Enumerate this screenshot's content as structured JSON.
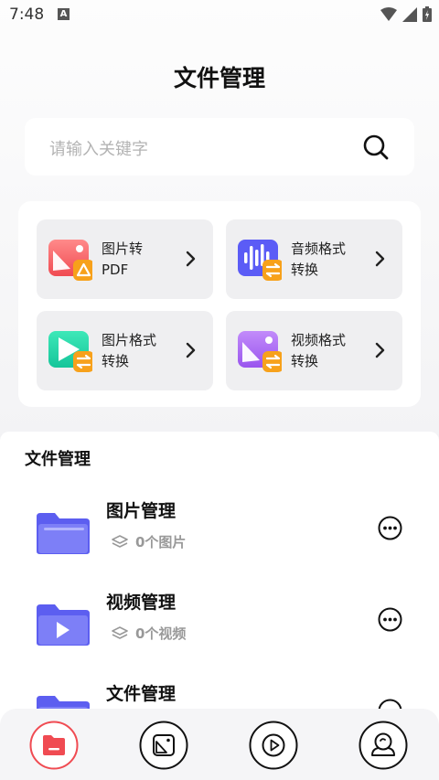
{
  "status_bar": {
    "time": "7:48",
    "notification_badge": "A"
  },
  "page_title": "文件管理",
  "search": {
    "placeholder": "请输入关键字"
  },
  "tools": [
    {
      "label_line1": "图片转",
      "label_line2": "PDF",
      "icon": "image-to-pdf-icon",
      "color": "#f2626b"
    },
    {
      "label_line1": "音频格式",
      "label_line2": "转换",
      "icon": "audio-convert-icon",
      "color": "#5b5cf6"
    },
    {
      "label_line1": "图片格式",
      "label_line2": "转换",
      "icon": "image-convert-icon",
      "color": "#22d2a5"
    },
    {
      "label_line1": "视频格式",
      "label_line2": "转换",
      "icon": "video-convert-icon",
      "color": "#b06ef0"
    }
  ],
  "section_title": "文件管理",
  "files": [
    {
      "name": "图片管理",
      "count": "0个图片"
    },
    {
      "name": "视频管理",
      "count": "0个视频"
    },
    {
      "name": "文件管理",
      "count": ""
    }
  ],
  "tab_bar": {
    "tabs": [
      {
        "name": "tab-files",
        "icon": "folder-icon",
        "active": true
      },
      {
        "name": "tab-images",
        "icon": "image-icon",
        "active": false
      },
      {
        "name": "tab-videos",
        "icon": "play-icon",
        "active": false
      },
      {
        "name": "tab-profile",
        "icon": "user-icon",
        "active": false
      }
    ]
  },
  "colors": {
    "accent": "#f04b52",
    "folder": "#6c6ef5",
    "badge": "#f7a11b"
  }
}
